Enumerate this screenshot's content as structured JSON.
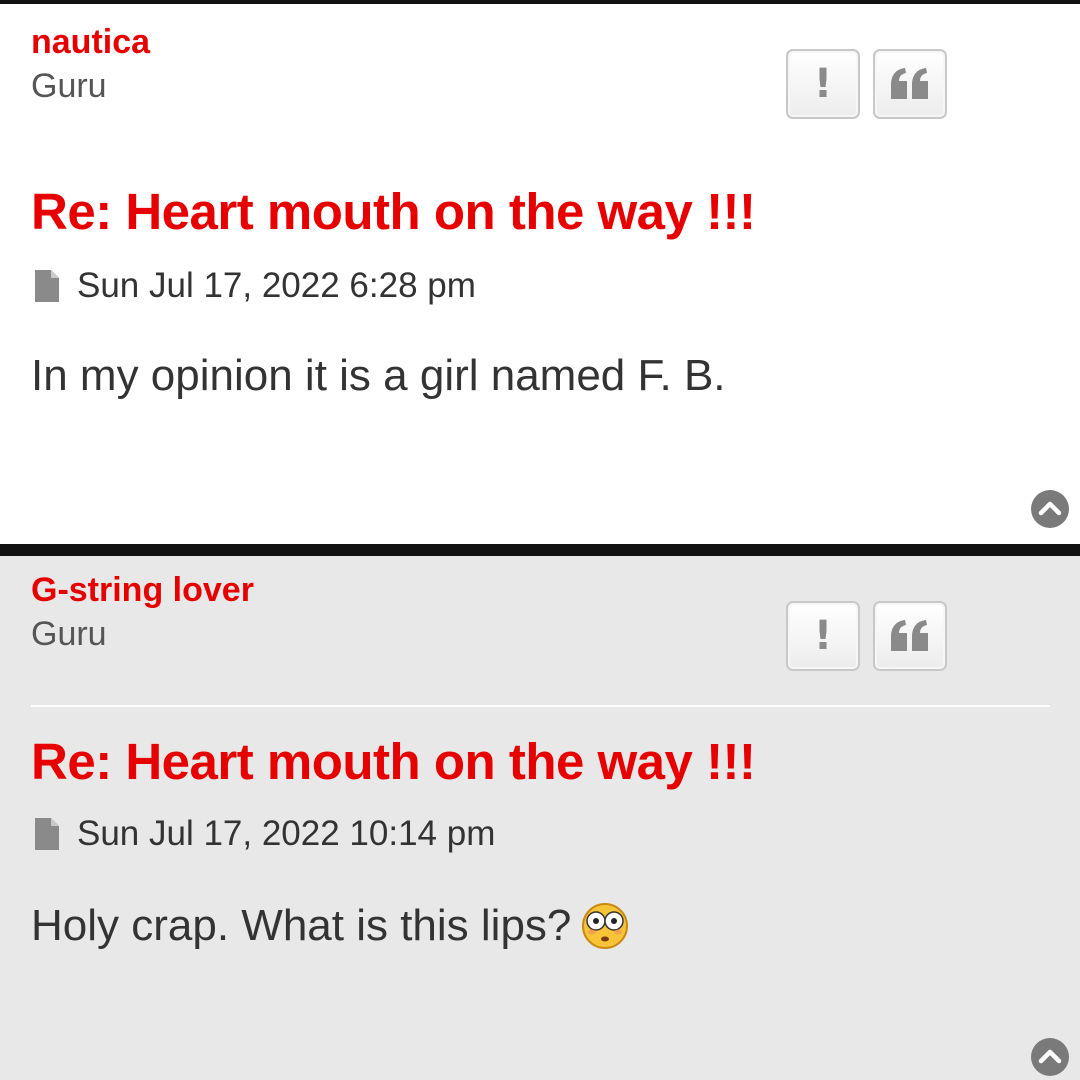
{
  "posts": [
    {
      "author": "nautica",
      "rank": "Guru",
      "title": "Re: Heart mouth on the way !!!",
      "date": "Sun Jul 17, 2022 6:28 pm",
      "body": "In my opinion it is a girl named F. B.",
      "report_glyph": "!",
      "quote_icon": "quote-icon",
      "top_icon": "chevron-up-icon"
    },
    {
      "author": "G-string lover",
      "rank": "Guru",
      "title": "Re: Heart mouth on the way !!!",
      "date": "Sun Jul 17, 2022 10:14 pm",
      "body": "Holy crap. What is this lips?",
      "emoji": "flushed-face-emoji",
      "report_glyph": "!",
      "quote_icon": "quote-icon",
      "top_icon": "chevron-up-icon"
    }
  ],
  "colors": {
    "accent": "#e60000",
    "text": "#333333",
    "muted": "#555555",
    "alt_background": "#e8e8e8"
  }
}
